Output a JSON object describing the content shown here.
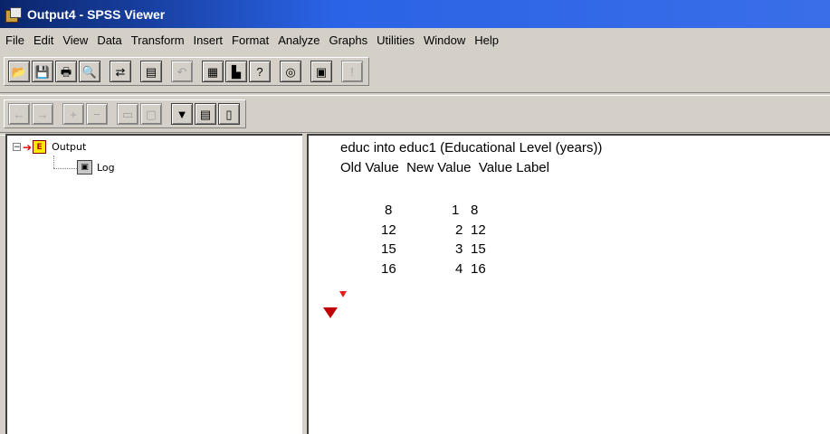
{
  "window": {
    "title": "Output4 - SPSS Viewer"
  },
  "menu": [
    "File",
    "Edit",
    "View",
    "Data",
    "Transform",
    "Insert",
    "Format",
    "Analyze",
    "Graphs",
    "Utilities",
    "Window",
    "Help"
  ],
  "toolbar1": [
    {
      "icon": "open-folder-icon",
      "glyph": "📂"
    },
    {
      "icon": "save-icon",
      "glyph": "💾"
    },
    {
      "icon": "print-icon",
      "glyph": "🖶"
    },
    {
      "icon": "print-preview-icon",
      "glyph": "🔍"
    },
    {
      "icon": "export-icon",
      "glyph": "⇄"
    },
    {
      "icon": "dialog-recall-icon",
      "glyph": "▤"
    },
    {
      "icon": "undo-icon",
      "glyph": "↶",
      "disabled": true
    },
    {
      "icon": "goto-data-icon",
      "glyph": "▦"
    },
    {
      "icon": "goto-chart-icon",
      "glyph": "▙"
    },
    {
      "icon": "variables-icon",
      "glyph": "?"
    },
    {
      "icon": "use-sets-icon",
      "glyph": "◎"
    },
    {
      "icon": "designate-window-icon",
      "glyph": "▣"
    },
    {
      "icon": "select-last-output-icon",
      "glyph": "!",
      "disabled": true
    }
  ],
  "toolbar2": [
    {
      "icon": "promote-icon",
      "glyph": "←",
      "disabled": true
    },
    {
      "icon": "demote-icon",
      "glyph": "→",
      "disabled": true
    },
    {
      "icon": "expand-icon",
      "glyph": "+",
      "disabled": true
    },
    {
      "icon": "collapse-icon",
      "glyph": "−",
      "disabled": true
    },
    {
      "icon": "show-icon",
      "glyph": "▭",
      "disabled": true
    },
    {
      "icon": "hide-icon",
      "glyph": "▢",
      "disabled": true
    },
    {
      "icon": "insert-heading-icon",
      "glyph": "▼"
    },
    {
      "icon": "insert-title-icon",
      "glyph": "▤"
    },
    {
      "icon": "insert-text-icon",
      "glyph": "▯"
    }
  ],
  "outline": {
    "root": {
      "label": "Output",
      "expander": "−"
    },
    "children": [
      {
        "label": "Log"
      }
    ]
  },
  "content": {
    "line1": "educ into educ1 (Educational Level (years))",
    "header": "Old Value  New Value  Value Label",
    "rows": [
      {
        "old": "8",
        "new": "1",
        "label": "8"
      },
      {
        "old": "12",
        "new": "2",
        "label": "12"
      },
      {
        "old": "15",
        "new": "3",
        "label": "15"
      },
      {
        "old": "16",
        "new": "4",
        "label": "16"
      }
    ]
  },
  "colors": {
    "titlebar_start": "#0a246a",
    "titlebar_end": "#3a6ee8",
    "marker_red": "#c00000",
    "window_bg": "#d4d0c8"
  }
}
